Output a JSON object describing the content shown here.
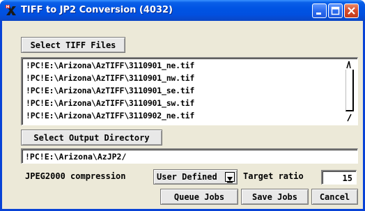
{
  "window": {
    "title": "TIFF to JP2 Conversion (4032)",
    "app_icon": "tntmips-x-icon"
  },
  "titlebar_buttons": {
    "minimize_icon": "minimize-icon",
    "maximize_icon": "maximize-icon",
    "close_icon": "close-icon"
  },
  "select_files": {
    "label": "Select TIFF Files"
  },
  "file_list": {
    "items": [
      "!PC!E:\\Arizona\\AzTIFF\\3110901_ne.tif",
      "!PC!E:\\Arizona\\AzTIFF\\3110901_nw.tif",
      "!PC!E:\\Arizona\\AzTIFF\\3110901_se.tif",
      "!PC!E:\\Arizona\\AzTIFF\\3110901_sw.tif",
      "!PC!E:\\Arizona\\AzTIFF\\3110902_ne.tif"
    ]
  },
  "select_output": {
    "label": "Select Output Directory"
  },
  "output_dir": {
    "value": "!PC!E:\\Arizona\\AzJP2/"
  },
  "compression": {
    "label": "JPEG2000 compression",
    "selected": "User Defined"
  },
  "target_ratio": {
    "label": "Target ratio",
    "value": "15"
  },
  "actions": {
    "queue_label": "Queue Jobs",
    "save_label": "Save Jobs",
    "cancel_label": "Cancel"
  },
  "colors": {
    "titlebar": "#0054e3",
    "window_bg": "#ece9d8",
    "close_button": "#d6492a"
  }
}
